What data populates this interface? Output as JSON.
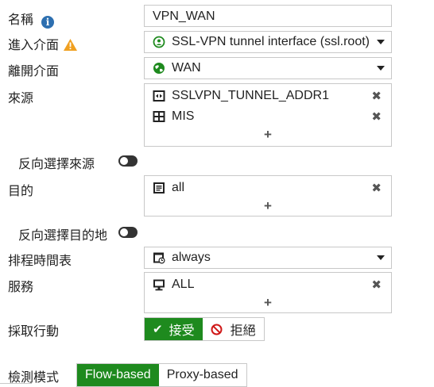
{
  "form": {
    "name": {
      "label": "名稱",
      "value": "VPN_WAN"
    },
    "incoming_interface": {
      "label": "進入介面",
      "value": "SSL-VPN tunnel interface (ssl.root)"
    },
    "outgoing_interface": {
      "label": "離開介面",
      "value": "WAN"
    },
    "source": {
      "label": "來源",
      "items": [
        {
          "text": "SSLVPN_TUNNEL_ADDR1",
          "icon": "address-range-icon"
        },
        {
          "text": "MIS",
          "icon": "address-group-icon"
        }
      ],
      "add": "+"
    },
    "negate_source": {
      "label": "反向選擇來源",
      "enabled": false
    },
    "destination": {
      "label": "目的",
      "items": [
        {
          "text": "all",
          "icon": "address-icon"
        }
      ],
      "add": "+"
    },
    "negate_destination": {
      "label": "反向選擇目的地",
      "enabled": false
    },
    "schedule": {
      "label": "排程時間表",
      "value": "always"
    },
    "service": {
      "label": "服務",
      "items": [
        {
          "text": "ALL",
          "icon": "service-icon"
        }
      ],
      "add": "+"
    },
    "action": {
      "label": "採取行動",
      "accept": "接受",
      "deny": "拒絕",
      "selected": "accept"
    },
    "inspection_mode": {
      "label": "檢測模式",
      "flow": "Flow-based",
      "proxy": "Proxy-based",
      "selected": "flow"
    }
  },
  "colors": {
    "accent_green": "#1e8a1e",
    "info_blue": "#2d6fb0",
    "warning_orange": "#f0a020"
  }
}
